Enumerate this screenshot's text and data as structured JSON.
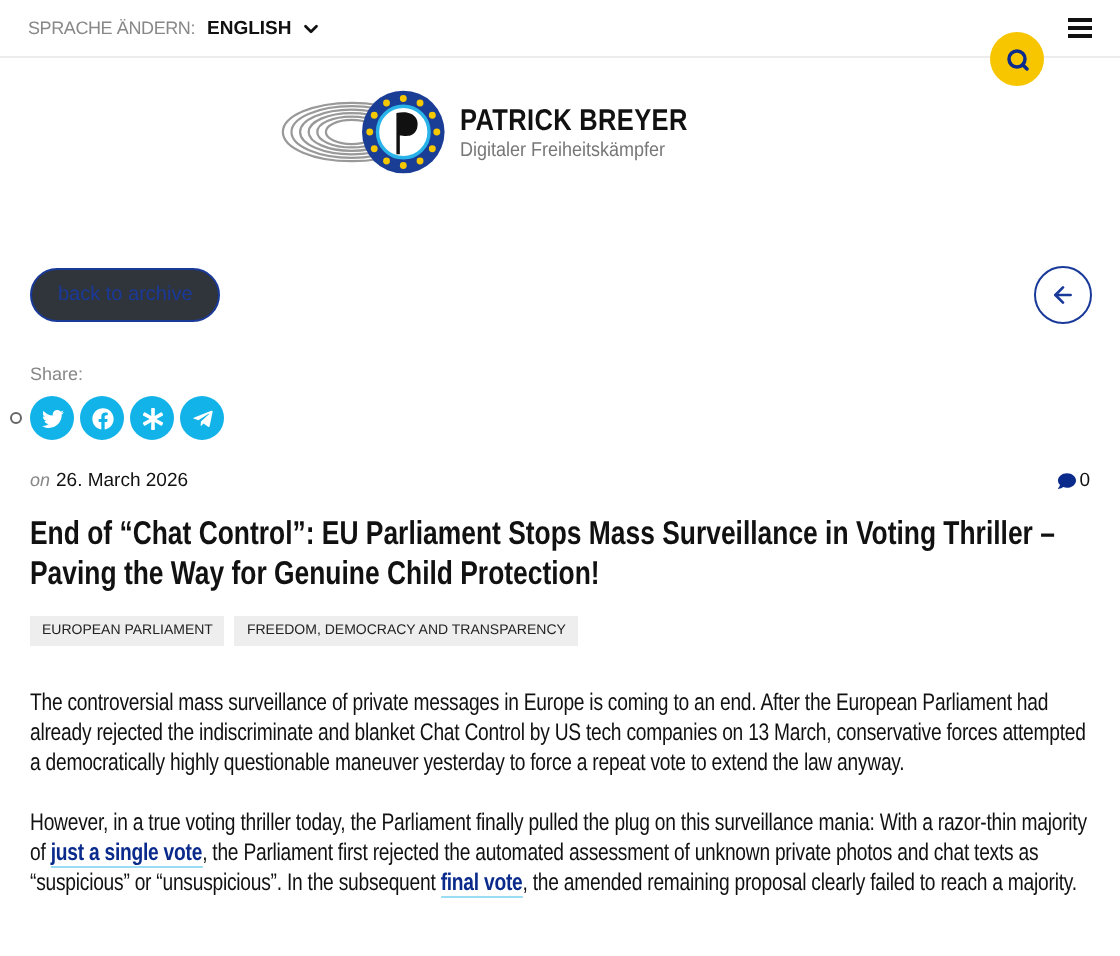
{
  "header": {
    "language_label": "SPRACHE ÄNDERN:",
    "language": "ENGLISH"
  },
  "site": {
    "name": "PATRICK BREYER",
    "tagline": "Digitaler Freiheitskämpfer"
  },
  "back_button": "back to archive",
  "share": {
    "label": "Share:",
    "buttons": [
      {
        "kind": "twitter"
      },
      {
        "kind": "facebook"
      },
      {
        "kind": "diaspora"
      },
      {
        "kind": "telegram"
      }
    ]
  },
  "post": {
    "date_prefix": "on",
    "date": "26. March 2026",
    "comment_count": "0",
    "title": "End of “Chat Control”: EU Parliament Stops Mass Surveillance in Voting Thriller – Paving the Way for Genuine Child Protection!",
    "tags": [
      "EUROPEAN PARLIAMENT",
      "FREEDOM, DEMOCRACY AND TRANSPARENCY"
    ],
    "paragraphs": [
      [
        {
          "kind": "text",
          "text": "The controversial mass surveillance of private messages in Europe is coming to an end. After the European Parliament had already rejected the indiscriminate and blanket Chat Control by US tech companies on 13 March, conservative forces attempted a democratically highly questionable maneuver yesterday to force a repeat vote to extend the law anyway."
        }
      ],
      [
        {
          "kind": "text",
          "text": "However, in a true voting thriller today, the Parliament finally pulled the plug on this surveillance mania: With a razor-thin majority of "
        },
        {
          "kind": "link",
          "text": "just a single vote"
        },
        {
          "kind": "text",
          "text": ", the Parliament first rejected the automated assessment of unknown private photos and chat texts as “suspicious” or “unsuspicious”. In the subsequent "
        },
        {
          "kind": "link",
          "text": "final vote"
        },
        {
          "kind": "text",
          "text": ", the amended remaining proposal clearly failed to reach a majority."
        }
      ]
    ]
  }
}
